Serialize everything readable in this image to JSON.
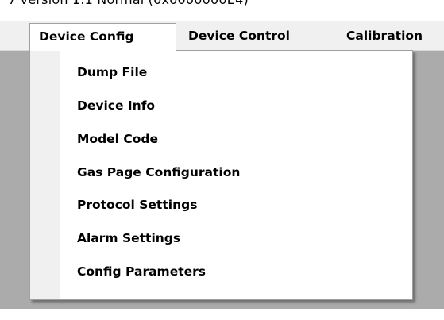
{
  "window": {
    "cut_off_title": "7   version 1.1 Normal (0x0000000E4)"
  },
  "menubar": {
    "items": [
      {
        "label": "Device Config"
      },
      {
        "label": "Device Control"
      },
      {
        "label": "Calibration"
      }
    ],
    "active_index": 0
  },
  "dropdown": {
    "items": [
      {
        "label": "Dump File"
      },
      {
        "label": "Device Info"
      },
      {
        "label": "Model Code"
      },
      {
        "label": "Gas Page Configuration"
      },
      {
        "label": "Protocol Settings"
      },
      {
        "label": "Alarm Settings"
      },
      {
        "label": "Config Parameters"
      }
    ]
  },
  "colors": {
    "background_gray": "#ababab",
    "menubar_bg": "#f0f0f0",
    "menu_border": "#a0a0a0",
    "text": "#000000"
  }
}
